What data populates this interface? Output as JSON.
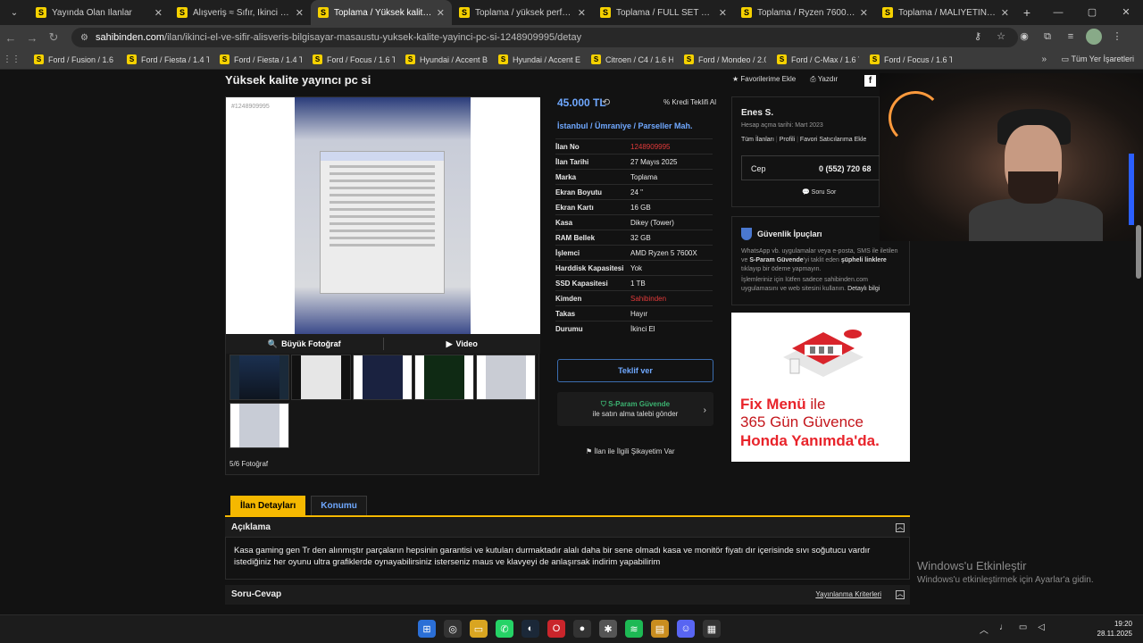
{
  "browser": {
    "tabs": [
      {
        "label": "Yayında Olan İlanlar",
        "active": false
      },
      {
        "label": "Alışveriş ≈ Sıfır, İkinci El Ürünler",
        "active": false
      },
      {
        "label": "Toplama / Yüksek kalite yayıncı",
        "active": true
      },
      {
        "label": "Toplama / yüksek performans o",
        "active": false
      },
      {
        "label": "Toplama / FULL SET OYUNCU E",
        "active": false
      },
      {
        "label": "Toplama / Ryzen 7600x Ekran K",
        "active": false
      },
      {
        "label": "Toplama / MALİYETİNİN YARISI",
        "active": false
      }
    ],
    "url_host": "sahibinden.com",
    "url_path": "/ilan/ikinci-el-ve-sifir-alisveris-bilgisayar-masaustu-yuksek-kalite-yayinci-pc-si-1248909995/detay",
    "bookmarks": [
      "Ford / Fusion / 1.6 ...",
      "Ford / Fiesta / 1.4 T...",
      "Ford / Fiesta / 1.4 T...",
      "Ford / Focus / 1.6 T...",
      "Hyundai / Accent Bl...",
      "Hyundai / Accent Er...",
      "Citroen / C4 / 1.6 H...",
      "Ford / Mondeo / 2.0...",
      "Ford / C-Max / 1.6 T...",
      "Ford / Focus / 1.6 T..."
    ],
    "all_bookmarks": "Tüm Yer İşaretleri"
  },
  "listing": {
    "title": "Yüksek kalite yayıncı pc si",
    "actions": {
      "favorite": "Favorilerime Ekle",
      "print": "Yazdır"
    },
    "photo_id": "#1248909995",
    "big_photo": "Büyük Fotoğraf",
    "video": "Video",
    "photo_count": "5/6 Fotoğraf",
    "price": "45.000 TL",
    "credit_offer": "Kredi Teklifi Al",
    "location": "İstanbul / Ümraniye / Parseller Mah.",
    "fields": [
      {
        "k": "İlan No",
        "v": "1248909995",
        "red": true
      },
      {
        "k": "İlan Tarihi",
        "v": "27 Mayıs 2025"
      },
      {
        "k": "Marka",
        "v": "Toplama"
      },
      {
        "k": "Ekran Boyutu",
        "v": "24 \""
      },
      {
        "k": "Ekran Kartı",
        "v": "16 GB"
      },
      {
        "k": "Kasa",
        "v": "Dikey (Tower)"
      },
      {
        "k": "RAM Bellek",
        "v": "32 GB"
      },
      {
        "k": "İşlemci",
        "v": "AMD Ryzen 5 7600X"
      },
      {
        "k": "Harddisk Kapasitesi",
        "v": "Yok"
      },
      {
        "k": "SSD Kapasitesi",
        "v": "1 TB"
      },
      {
        "k": "Kimden",
        "v": "Sahibinden",
        "red": true
      },
      {
        "k": "Takas",
        "v": "Hayır"
      },
      {
        "k": "Durumu",
        "v": "İkinci El"
      }
    ],
    "offer_button": "Teklif ver",
    "sparam_title": "S-Param Güvende",
    "sparam_text": "ile satın alma talebi gönder",
    "report": "İlan ile İlgili Şikayetim Var"
  },
  "seller": {
    "name": "Enes S.",
    "since": "Hesap açma tarihi: Mart 2023",
    "links": [
      "Tüm İlanları",
      "Profili",
      "Favori Satıcılarıma Ekle"
    ],
    "phone_label": "Cep",
    "phone": "0 (552) 720 68",
    "ask": "Soru Sor"
  },
  "security": {
    "title": "Güvenlik İpuçları",
    "text1_a": "WhatsApp vb. uygulamalar veya e-posta, SMS ile iletilen ve ",
    "text1_b": "S-Param Güvende",
    "text1_c": "'yi taklit eden ",
    "text1_d": "şüpheli linklere",
    "text1_e": " tıklayıp bir ödeme yapmayın.",
    "text2": "İşlemleriniz için lütfen sadece sahibinden.com uygulamasını ve web sitesini kullanın.",
    "link": "Detaylı bilgi"
  },
  "ad": {
    "line1_bold": "Fix Menü",
    "line1_plain": " ile",
    "line2": "365 Gün Güvence",
    "line3": "Honda Yanımda'da."
  },
  "details_tabs": [
    "İlan Detayları",
    "Konumu"
  ],
  "description": {
    "heading": "Açıklama",
    "text": "Kasa gaming gen Tr den alınmıştır parçaların hepsinin garantisi ve kutuları durmaktadır alalı daha bir sene olmadı kasa ve monitör fiyatı dır içerisinde sıvı soğutucu vardır istediğiniz her oyunu ultra grafiklerde oynayabilirsiniz isterseniz maus ve klavyeyi de anlaşırsak indirim yapabilirim"
  },
  "qa": {
    "heading": "Soru-Cevap",
    "criteria": "Yayınlanma Kriterleri"
  },
  "windows": {
    "activate_title": "Windows'u Etkinleştir",
    "activate_text": "Windows'u etkinleştirmek için Ayarlar'a gidin.",
    "time": "19:20",
    "date": "28.11.2025"
  }
}
